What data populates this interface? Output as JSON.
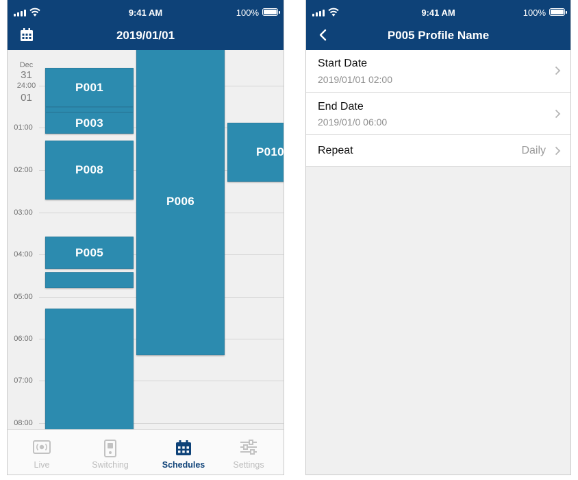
{
  "status_bar": {
    "time": "9:41 AM",
    "battery": "100%"
  },
  "schedule_screen": {
    "title": "2019/01/01",
    "date_labels": {
      "month": "Dec",
      "prev_day": "31",
      "midnight": "24:00",
      "day": "01"
    },
    "hours": [
      "01:00",
      "02:00",
      "03:00",
      "04:00",
      "05:00",
      "06:00",
      "07:00",
      "08:00"
    ],
    "events": [
      {
        "label": "P001"
      },
      {
        "label": ""
      },
      {
        "label": "P003"
      },
      {
        "label": "P008"
      },
      {
        "label": "P005"
      },
      {
        "label": ""
      },
      {
        "label": ""
      },
      {
        "label": "P006"
      },
      {
        "label": "P010"
      }
    ],
    "tabs": [
      {
        "label": "Live",
        "icon": "live-camera-icon",
        "active": false
      },
      {
        "label": "Switching",
        "icon": "switching-icon",
        "active": false
      },
      {
        "label": "Schedules",
        "icon": "calendar-icon",
        "active": true
      },
      {
        "label": "Settings",
        "icon": "sliders-icon",
        "active": false
      }
    ]
  },
  "profile_screen": {
    "title": "P005 Profile Name",
    "rows": [
      {
        "title": "Start Date",
        "subtitle": "2019/01/01 02:00"
      },
      {
        "title": "End Date",
        "subtitle": "2019/01/0 06:00"
      },
      {
        "title": "Repeat",
        "value": "Daily"
      }
    ]
  },
  "colors": {
    "header": "#0e4278",
    "event": "#2c8baf",
    "active_tab": "#0e4278",
    "inactive_tab": "#bdbdbd",
    "background": "#f0f0f0"
  }
}
